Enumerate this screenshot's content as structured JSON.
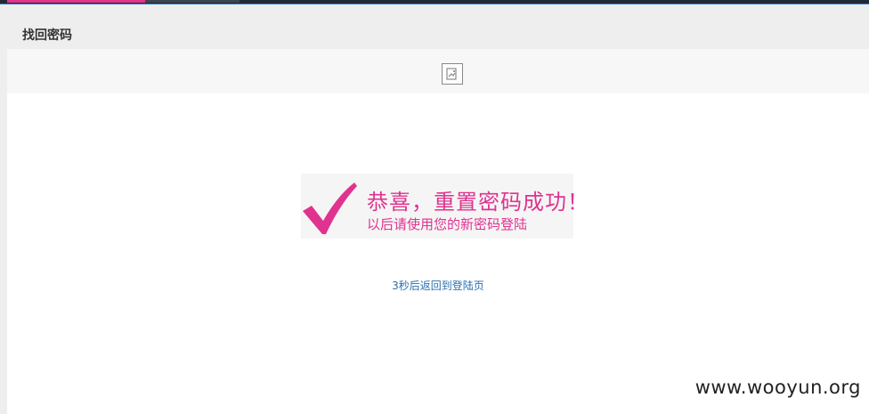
{
  "header": {
    "title": "找回密码"
  },
  "success": {
    "title": "恭喜，重置密码成功！",
    "subtitle": "以后请使用您的新密码登陆"
  },
  "redirect": {
    "text": "3秒后返回到登陆页"
  },
  "watermark": {
    "text": "www.wooyun.org"
  },
  "colors": {
    "accent": "#e0338f",
    "link": "#2a6fb0",
    "topbar": "#1f2a36"
  },
  "icons": {
    "logo": "broken-image-icon",
    "success": "checkmark-icon"
  }
}
